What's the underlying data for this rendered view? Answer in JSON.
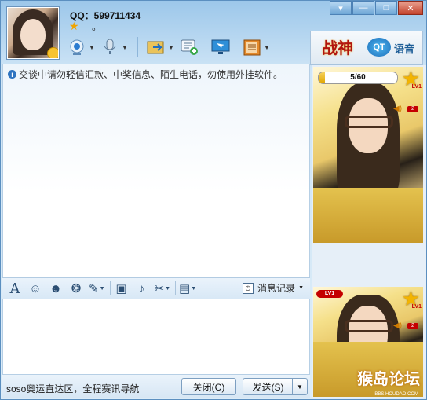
{
  "window": {
    "qq_label": "QQ：599711434",
    "status_dot": "。",
    "controls": {
      "menu": "▾",
      "min": "—",
      "max": "□",
      "close": "✕"
    }
  },
  "toolbar": {
    "items": [
      {
        "name": "video-call",
        "icon": "webcam-icon"
      },
      {
        "name": "voice-call",
        "icon": "microphone-icon"
      },
      {
        "name": "file-transfer",
        "icon": "folder-icon"
      },
      {
        "name": "group-chat",
        "icon": "chat-add-icon"
      },
      {
        "name": "remote-assist",
        "icon": "monitor-icon"
      },
      {
        "name": "apps",
        "icon": "app-box-icon"
      }
    ]
  },
  "ad": {
    "game_logo": "战神",
    "qt_label": "QT",
    "qt_text": "语音"
  },
  "chat": {
    "notice_icon": "i",
    "notice": "交谈中请勿轻信汇款、中奖信息、陌生电话，勿使用外挂软件。"
  },
  "format_bar": {
    "items": [
      {
        "name": "font",
        "glyph": "A"
      },
      {
        "name": "emoji",
        "glyph": "☺"
      },
      {
        "name": "magic-face",
        "glyph": "☻"
      },
      {
        "name": "shake",
        "glyph": "❂"
      },
      {
        "name": "doodle",
        "glyph": "✎"
      },
      {
        "name": "image",
        "glyph": "▣"
      },
      {
        "name": "music",
        "glyph": "♪"
      },
      {
        "name": "screenshot",
        "glyph": "✂"
      },
      {
        "name": "briefcase",
        "glyph": "▤"
      }
    ],
    "history_label": "消息记录"
  },
  "bottom": {
    "soso_text": "soso奥运直达区，全程赛讯导航",
    "close_label": "关闭(C)",
    "send_label": "发送(S)"
  },
  "right": {
    "progress_text": "5/60",
    "progress_fraction": 0.083,
    "level_text": "LV1",
    "badge": "2",
    "watermark": "猴岛论坛",
    "watermark_sub": "BBS.HOUDAO.COM"
  }
}
